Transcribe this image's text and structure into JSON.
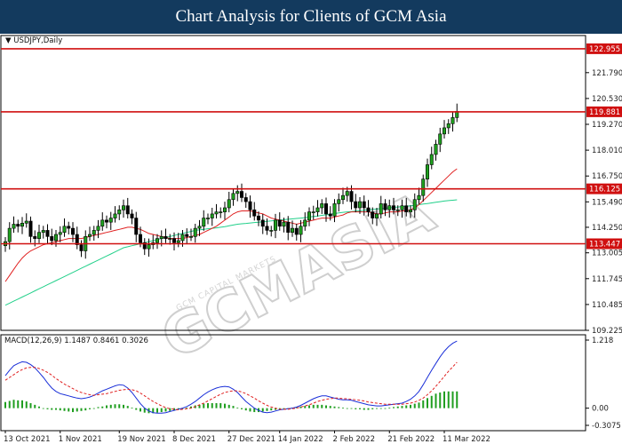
{
  "header": {
    "title": "Chart Analysis for Clients of GCM Asia"
  },
  "watermark": {
    "text": "GCMASIA",
    "sub": "GCM CAPITAL MARKETS"
  },
  "chart_data": [
    {
      "type": "candlestick",
      "symbol_label": "USDJPY,Daily",
      "ylim": [
        109.225,
        123.6
      ],
      "price_ticks": [
        121.79,
        120.53,
        119.27,
        118.01,
        116.75,
        115.49,
        114.25,
        113.005,
        111.745,
        110.485,
        109.225
      ],
      "x_tick_labels": [
        {
          "label": "13 Oct 2021",
          "i": 0
        },
        {
          "label": "1 Nov 2021",
          "i": 13
        },
        {
          "label": "19 Nov 2021",
          "i": 27
        },
        {
          "label": "8 Dec 2021",
          "i": 40
        },
        {
          "label": "27 Dec 2021",
          "i": 53
        },
        {
          "label": "14 Jan 2022",
          "i": 65
        },
        {
          "label": "2 Feb 2022",
          "i": 78
        },
        {
          "label": "21 Feb 2022",
          "i": 91
        },
        {
          "label": "11 Mar 2022",
          "i": 104
        }
      ],
      "levels": [
        {
          "value": 122.955,
          "label": "122.955"
        },
        {
          "value": 119.881,
          "label": "119.881"
        },
        {
          "value": 116.125,
          "label": "116.125"
        },
        {
          "value": 113.447,
          "label": "113.447"
        }
      ],
      "closes": [
        113.55,
        114.2,
        114.4,
        114.3,
        114.45,
        114.55,
        113.8,
        113.7,
        114.0,
        114.1,
        113.8,
        113.6,
        113.9,
        114.0,
        114.3,
        114.2,
        113.9,
        113.4,
        113.1,
        113.8,
        113.9,
        114.1,
        114.3,
        114.6,
        114.5,
        114.7,
        114.9,
        115.1,
        115.3,
        114.9,
        114.7,
        113.9,
        113.5,
        113.2,
        113.4,
        113.5,
        113.7,
        113.8,
        113.7,
        113.7,
        113.5,
        113.6,
        113.9,
        113.8,
        113.8,
        114.2,
        114.3,
        114.7,
        114.7,
        114.9,
        115.0,
        115.0,
        115.2,
        115.6,
        115.9,
        116.0,
        115.7,
        115.5,
        115.1,
        114.8,
        114.6,
        114.3,
        114.1,
        114.1,
        114.6,
        114.3,
        114.5,
        114.0,
        114.2,
        113.9,
        114.3,
        114.6,
        115.0,
        115.0,
        115.2,
        115.4,
        114.9,
        114.8,
        115.4,
        115.6,
        115.8,
        116.0,
        115.5,
        115.2,
        115.5,
        115.2,
        115.0,
        114.7,
        114.9,
        115.4,
        115.1,
        115.3,
        115.1,
        115.1,
        115.3,
        115.0,
        115.1,
        115.6,
        115.8,
        116.6,
        117.3,
        117.8,
        118.3,
        118.8,
        119.1,
        119.3,
        119.6,
        119.9
      ],
      "ma_fast": {
        "color": "#e02020",
        "values": [
          111.6,
          111.9,
          112.2,
          112.5,
          112.75,
          112.95,
          113.1,
          113.2,
          113.3,
          113.4,
          113.45,
          113.5,
          113.55,
          113.6,
          113.65,
          113.7,
          113.7,
          113.7,
          113.7,
          113.75,
          113.8,
          113.85,
          113.9,
          113.95,
          114.0,
          114.05,
          114.1,
          114.15,
          114.2,
          114.25,
          114.25,
          114.2,
          114.15,
          114.05,
          113.95,
          113.9,
          113.85,
          113.8,
          113.75,
          113.7,
          113.7,
          113.7,
          113.7,
          113.75,
          113.8,
          113.85,
          113.9,
          114.0,
          114.1,
          114.2,
          114.3,
          114.45,
          114.6,
          114.75,
          114.9,
          115.0,
          115.05,
          115.05,
          115.05,
          115.0,
          114.95,
          114.9,
          114.8,
          114.7,
          114.65,
          114.6,
          114.55,
          114.5,
          114.45,
          114.4,
          114.45,
          114.5,
          114.55,
          114.6,
          114.65,
          114.7,
          114.7,
          114.7,
          114.75,
          114.8,
          114.85,
          114.95,
          115.0,
          115.0,
          115.0,
          115.0,
          115.0,
          114.95,
          114.9,
          114.9,
          114.95,
          115.0,
          115.0,
          115.0,
          115.05,
          115.05,
          115.1,
          115.2,
          115.35,
          115.55,
          115.75,
          115.95,
          116.15,
          116.35,
          116.55,
          116.75,
          116.95,
          117.1
        ]
      },
      "ma_slow": {
        "color": "#22d08a",
        "values": [
          110.45,
          110.55,
          110.65,
          110.75,
          110.85,
          110.95,
          111.05,
          111.15,
          111.25,
          111.35,
          111.45,
          111.55,
          111.65,
          111.75,
          111.85,
          111.95,
          112.05,
          112.15,
          112.25,
          112.35,
          112.45,
          112.55,
          112.65,
          112.75,
          112.85,
          112.95,
          113.05,
          113.15,
          113.25,
          113.3,
          113.35,
          113.4,
          113.45,
          113.5,
          113.55,
          113.6,
          113.65,
          113.7,
          113.75,
          113.8,
          113.85,
          113.9,
          113.95,
          114.0,
          114.05,
          114.1,
          114.12,
          114.15,
          114.18,
          114.2,
          114.22,
          114.25,
          114.28,
          114.32,
          114.36,
          114.4,
          114.42,
          114.44,
          114.46,
          114.48,
          114.5,
          114.52,
          114.54,
          114.56,
          114.58,
          114.6,
          114.62,
          114.64,
          114.66,
          114.68,
          114.7,
          114.72,
          114.75,
          114.78,
          114.8,
          114.83,
          114.86,
          114.89,
          114.92,
          114.95,
          114.98,
          115.0,
          115.02,
          115.04,
          115.06,
          115.08,
          115.1,
          115.12,
          115.14,
          115.16,
          115.18,
          115.2,
          115.22,
          115.24,
          115.26,
          115.28,
          115.3,
          115.32,
          115.35,
          115.38,
          115.41,
          115.44,
          115.47,
          115.5,
          115.53,
          115.55,
          115.57,
          115.59
        ]
      }
    },
    {
      "type": "macd",
      "label": "MACD(12,26,9) 1.1487 0.8461 0.3026",
      "ylim": [
        -0.3075,
        1.218
      ],
      "ticks": [
        1.218,
        0.0,
        -0.3075
      ],
      "macd_color": "#1a2fd8",
      "signal_color": "#e02020",
      "hist_color": "#1f9e1f",
      "macd": [
        0.58,
        0.68,
        0.76,
        0.8,
        0.83,
        0.82,
        0.78,
        0.72,
        0.64,
        0.55,
        0.45,
        0.36,
        0.3,
        0.26,
        0.24,
        0.22,
        0.2,
        0.18,
        0.17,
        0.18,
        0.2,
        0.23,
        0.27,
        0.31,
        0.34,
        0.37,
        0.4,
        0.42,
        0.41,
        0.36,
        0.28,
        0.18,
        0.08,
        0.0,
        -0.05,
        -0.08,
        -0.09,
        -0.09,
        -0.08,
        -0.06,
        -0.04,
        -0.02,
        0.0,
        0.03,
        0.07,
        0.12,
        0.18,
        0.24,
        0.29,
        0.33,
        0.36,
        0.38,
        0.39,
        0.38,
        0.34,
        0.28,
        0.2,
        0.12,
        0.06,
        0.0,
        -0.04,
        -0.07,
        -0.08,
        -0.07,
        -0.05,
        -0.03,
        -0.02,
        -0.01,
        0.0,
        0.02,
        0.05,
        0.09,
        0.13,
        0.17,
        0.2,
        0.22,
        0.22,
        0.2,
        0.18,
        0.16,
        0.15,
        0.15,
        0.14,
        0.12,
        0.1,
        0.08,
        0.06,
        0.05,
        0.04,
        0.04,
        0.05,
        0.06,
        0.07,
        0.08,
        0.09,
        0.12,
        0.16,
        0.22,
        0.3,
        0.42,
        0.55,
        0.68,
        0.8,
        0.92,
        1.02,
        1.1,
        1.16,
        1.2
      ],
      "signal": [
        0.5,
        0.55,
        0.6,
        0.65,
        0.69,
        0.72,
        0.73,
        0.73,
        0.71,
        0.68,
        0.64,
        0.59,
        0.53,
        0.48,
        0.43,
        0.39,
        0.35,
        0.31,
        0.28,
        0.26,
        0.24,
        0.23,
        0.24,
        0.25,
        0.26,
        0.28,
        0.3,
        0.32,
        0.33,
        0.34,
        0.33,
        0.31,
        0.27,
        0.22,
        0.17,
        0.12,
        0.08,
        0.04,
        0.01,
        -0.01,
        -0.02,
        -0.03,
        -0.02,
        -0.01,
        0.0,
        0.03,
        0.06,
        0.09,
        0.13,
        0.17,
        0.21,
        0.25,
        0.28,
        0.3,
        0.31,
        0.31,
        0.29,
        0.26,
        0.22,
        0.18,
        0.13,
        0.09,
        0.05,
        0.02,
        0.0,
        -0.02,
        -0.02,
        -0.02,
        -0.01,
        0.0,
        0.02,
        0.04,
        0.06,
        0.09,
        0.12,
        0.14,
        0.16,
        0.17,
        0.18,
        0.18,
        0.17,
        0.17,
        0.16,
        0.15,
        0.14,
        0.13,
        0.11,
        0.1,
        0.09,
        0.08,
        0.07,
        0.07,
        0.07,
        0.07,
        0.07,
        0.08,
        0.09,
        0.11,
        0.14,
        0.18,
        0.24,
        0.31,
        0.39,
        0.48,
        0.57,
        0.66,
        0.74,
        0.82
      ],
      "histogram": [
        0.11,
        0.13,
        0.15,
        0.14,
        0.14,
        0.12,
        0.09,
        0.06,
        0.03,
        0.0,
        -0.02,
        -0.03,
        -0.03,
        -0.04,
        -0.05,
        -0.06,
        -0.07,
        -0.06,
        -0.05,
        -0.04,
        -0.02,
        0.0,
        0.02,
        0.03,
        0.05,
        0.06,
        0.07,
        0.07,
        0.06,
        0.04,
        0.01,
        -0.03,
        -0.06,
        -0.08,
        -0.09,
        -0.09,
        -0.08,
        -0.07,
        -0.06,
        -0.05,
        -0.04,
        -0.02,
        -0.01,
        0.01,
        0.03,
        0.05,
        0.06,
        0.08,
        0.09,
        0.09,
        0.09,
        0.09,
        0.08,
        0.06,
        0.04,
        0.01,
        -0.02,
        -0.04,
        -0.06,
        -0.07,
        -0.07,
        -0.06,
        -0.05,
        -0.04,
        -0.03,
        -0.02,
        -0.01,
        0.0,
        0.01,
        0.02,
        0.03,
        0.04,
        0.05,
        0.06,
        0.06,
        0.06,
        0.05,
        0.04,
        0.03,
        0.02,
        0.01,
        0.0,
        -0.01,
        -0.02,
        -0.02,
        -0.03,
        -0.03,
        -0.02,
        -0.01,
        0.0,
        0.0,
        0.01,
        0.02,
        0.03,
        0.04,
        0.05,
        0.06,
        0.08,
        0.1,
        0.14,
        0.18,
        0.22,
        0.26,
        0.28,
        0.3,
        0.3,
        0.3,
        0.3
      ]
    }
  ]
}
